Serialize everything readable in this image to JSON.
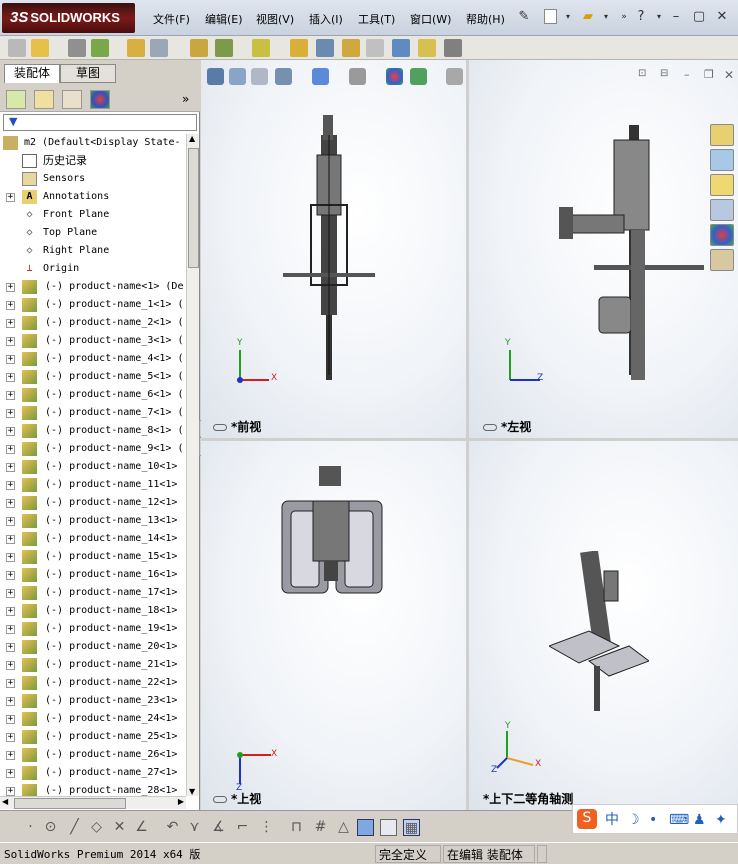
{
  "app": {
    "name": "SOLIDWORKS",
    "logo_prefix": "3S"
  },
  "menu": [
    "文件(F)",
    "编辑(E)",
    "视图(V)",
    "插入(I)",
    "工具(T)",
    "窗口(W)",
    "帮助(H)"
  ],
  "window_buttons": [
    "minimize-icon",
    "restore-icon",
    "close-icon"
  ],
  "left_tabs": [
    "装配体",
    "草图"
  ],
  "tree": {
    "root": "m2  (Default<Display State-",
    "history": "历史记录",
    "sensors": "Sensors",
    "annotations": "Annotations",
    "planes": [
      "Front Plane",
      "Top Plane",
      "Right Plane"
    ],
    "origin": "Origin",
    "components": [
      "(-) product-name<1> (De",
      "(-) product-name_1<1> (",
      "(-) product-name_2<1> (",
      "(-) product-name_3<1> (",
      "(-) product-name_4<1> (",
      "(-) product-name_5<1> (",
      "(-) product-name_6<1> (",
      "(-) product-name_7<1> (",
      "(-) product-name_8<1> (",
      "(-) product-name_9<1> (",
      "(-) product-name_10<1>",
      "(-) product-name_11<1>",
      "(-) product-name_12<1>",
      "(-) product-name_13<1>",
      "(-) product-name_14<1>",
      "(-) product-name_15<1>",
      "(-) product-name_16<1>",
      "(-) product-name_17<1>",
      "(-) product-name_18<1>",
      "(-) product-name_19<1>",
      "(-) product-name_20<1>",
      "(-) product-name_21<1>",
      "(-) product-name_22<1>",
      "(-) product-name_23<1>",
      "(-) product-name_24<1>",
      "(-) product-name_25<1>",
      "(-) product-name_26<1>",
      "(-) product-name_27<1>",
      "(-) product-name_28<1>"
    ]
  },
  "viewports": {
    "front": "*前视",
    "left": "*左视",
    "top": "*上视",
    "iso": "*上下二等角轴测"
  },
  "axes": {
    "x": "X",
    "y": "Y",
    "z": "Z"
  },
  "status": {
    "product": "SolidWorks Premium 2014 x64 版",
    "definition": "完全定义",
    "mode": "在编辑 装配体"
  },
  "ime": {
    "mode": "中"
  },
  "colors": {
    "logo": "#7a1a1a",
    "axis_x": "#d02020",
    "axis_y": "#20a020",
    "axis_z": "#2030c0"
  }
}
